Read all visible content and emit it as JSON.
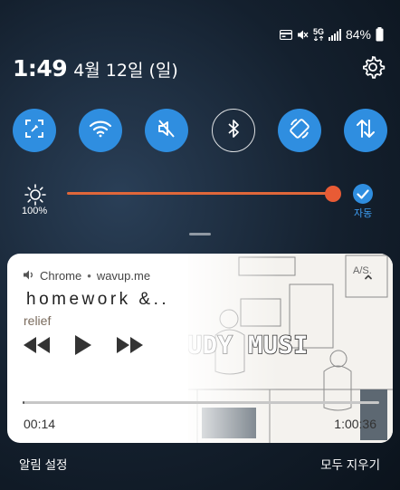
{
  "status_bar": {
    "battery_percent": "84%",
    "network_label": "5G",
    "icons": [
      "card-icon",
      "mute-icon",
      "5g-icon",
      "signal-icon",
      "battery-icon"
    ]
  },
  "header": {
    "time": "1:49",
    "date": "4월 12일 (일)"
  },
  "quick_toggles": [
    {
      "name": "screen-capture",
      "icon": "screen-capture-icon",
      "state": "on"
    },
    {
      "name": "wifi",
      "icon": "wifi-icon",
      "state": "on"
    },
    {
      "name": "mute",
      "icon": "mute-icon",
      "state": "on"
    },
    {
      "name": "bluetooth",
      "icon": "bluetooth-icon",
      "state": "off"
    },
    {
      "name": "auto-rotate",
      "icon": "rotate-icon",
      "state": "on"
    },
    {
      "name": "mobile-data",
      "icon": "data-arrows-icon",
      "state": "on"
    }
  ],
  "brightness": {
    "value_label": "100%",
    "level": 1.0,
    "auto_label": "자동",
    "auto_enabled": true
  },
  "media": {
    "app": "Chrome",
    "separator": "•",
    "source": "wavup.me",
    "title": "homework &..",
    "artist": "relief",
    "current_time": "00:14",
    "total_time": "1:00:36",
    "progress": 0.0039,
    "artwork_text": "UDY MUSI",
    "artwork_sign": "A/S."
  },
  "footer": {
    "notification_settings": "알림 설정",
    "clear_all": "모두 지우기"
  },
  "colors": {
    "toggle_on": "#2f8ee0",
    "slider": "#e85b35",
    "accent": "#3d9cf0"
  }
}
